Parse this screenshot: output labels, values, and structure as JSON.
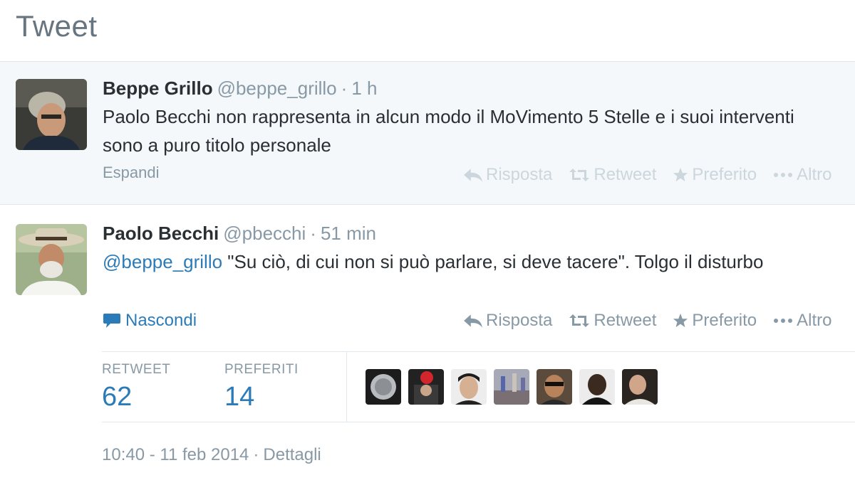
{
  "page": {
    "title": "Tweet"
  },
  "tweets": [
    {
      "fullname": "Beppe Grillo",
      "username": "@beppe_grillo",
      "separator": "·",
      "time": "1 h",
      "text": "Paolo Becchi non rappresenta in alcun modo il MoVimento 5 Stelle e i suoi interventi sono a puro titolo personale",
      "expand_label": "Espandi",
      "actions": {
        "reply": "Risposta",
        "retweet": "Retweet",
        "favorite": "Preferito",
        "more": "Altro"
      }
    },
    {
      "fullname": "Paolo Becchi",
      "username": "@pbecchi",
      "separator": "·",
      "time": "51 min",
      "mention": "@beppe_grillo",
      "text": " \"Su ciò, di cui non si può parlare, si deve tacere\". Tolgo il disturbo",
      "hide_label": "Nascondi",
      "actions": {
        "reply": "Risposta",
        "retweet": "Retweet",
        "favorite": "Preferito",
        "more": "Altro"
      },
      "stats": {
        "retweets_label": "RETWEET",
        "retweets_count": "62",
        "favorites_label": "PREFERITI",
        "favorites_count": "14"
      },
      "footer": {
        "timestamp": "10:40 - 11 feb 2014",
        "separator": "·",
        "details_link": "Dettagli"
      }
    }
  ],
  "colors": {
    "link": "#2b7bb9",
    "muted": "#8899a6",
    "text": "#292f33",
    "highlight_bg": "#f5f8fa"
  },
  "icons": {
    "reply": "reply-icon",
    "retweet": "retweet-icon",
    "favorite": "star-icon",
    "more": "more-dots-icon",
    "conversation": "speech-bubble-icon"
  }
}
